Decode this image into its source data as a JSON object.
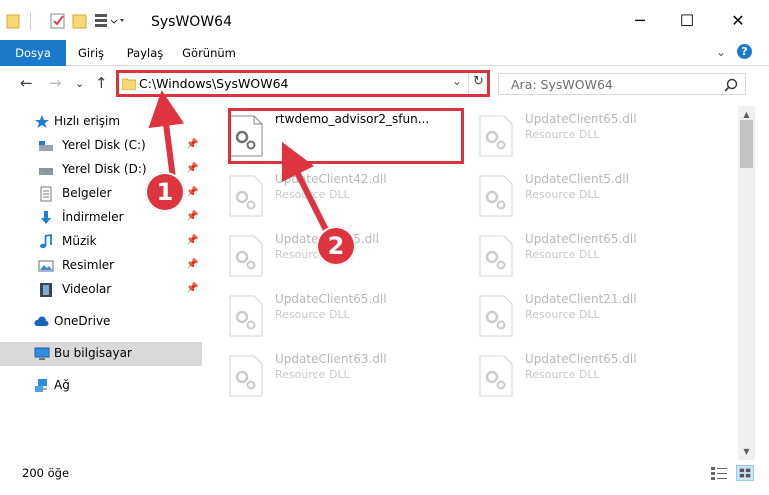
{
  "window": {
    "title": "SysWOW64",
    "minimize": "─",
    "maximize": "☐",
    "close": "✕"
  },
  "ribbon": {
    "tabs": [
      "Dosya",
      "Giriş",
      "Paylaş",
      "Görünüm"
    ],
    "active": 0,
    "expand": "⌄",
    "help": "?"
  },
  "nav": {
    "back": "←",
    "forward": "→",
    "recent": "⌄",
    "up": "↑"
  },
  "address": {
    "path": "C:\\Windows\\SysWOW64",
    "dropdown": "⌄",
    "refresh": "↻"
  },
  "search": {
    "placeholder": "Ara: SysWOW64"
  },
  "navpane": {
    "items": [
      {
        "label": "Hızlı erişim",
        "icon": "star-icon",
        "top": true
      },
      {
        "label": "Yerel Disk (C:)",
        "icon": "drive-icon",
        "pinned": true
      },
      {
        "label": "Yerel Disk (D:)",
        "icon": "drive-icon",
        "pinned": true
      },
      {
        "label": "Belgeler",
        "icon": "documents-icon",
        "pinned": true
      },
      {
        "label": "İndirmeler",
        "icon": "download-icon",
        "pinned": true
      },
      {
        "label": "Müzik",
        "icon": "music-icon",
        "pinned": true
      },
      {
        "label": "Resimler",
        "icon": "pictures-icon",
        "pinned": true
      },
      {
        "label": "Videolar",
        "icon": "videos-icon",
        "pinned": true
      },
      {
        "label": "OneDrive",
        "icon": "cloud-icon",
        "top": true
      },
      {
        "label": "Bu bilgisayar",
        "icon": "computer-icon",
        "top": true,
        "selected": true
      },
      {
        "label": "Ağ",
        "icon": "network-icon",
        "top": true
      }
    ]
  },
  "files": [
    {
      "name": "rtwdemo_advisor2_sfun...",
      "type": "",
      "main": true
    },
    {
      "name": "UpdateClient65.dll",
      "type": "Resource DLL"
    },
    {
      "name": "UpdateClient42.dll",
      "type": "Resource DLL"
    },
    {
      "name": "UpdateClient5.dll",
      "type": "Resource DLL"
    },
    {
      "name": "UpdateClient5.dll",
      "type": "Resource DLL"
    },
    {
      "name": "UpdateClient65.dll",
      "type": "Resource DLL"
    },
    {
      "name": "UpdateClient65.dll",
      "type": "Resource DLL"
    },
    {
      "name": "UpdateClient21.dll",
      "type": "Resource DLL"
    },
    {
      "name": "UpdateClient63.dll",
      "type": "Resource DLL"
    },
    {
      "name": "UpdateClient65.dll",
      "type": "Resource DLL"
    }
  ],
  "status": {
    "count": "200 öğe"
  },
  "callouts": {
    "first": "1",
    "second": "2"
  },
  "colors": {
    "accent": "#1979ca",
    "highlight": "#d7353c",
    "callout": "#dd3440"
  }
}
